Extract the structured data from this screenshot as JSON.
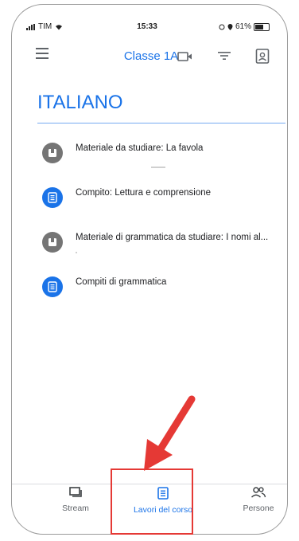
{
  "status_bar": {
    "carrier": "TIM",
    "time": "15:33",
    "battery": "61%"
  },
  "app_bar": {
    "title": "Classe 1A"
  },
  "section": {
    "title": "ITALIANO"
  },
  "items": [
    {
      "label": "Materiale da studiare: La favola",
      "icon": "material-icon",
      "type": "material"
    },
    {
      "label": "Compito: Lettura e comprensione",
      "icon": "assignment-icon",
      "type": "assignment"
    },
    {
      "label": "Materiale di grammatica da studiare: I nomi al...",
      "icon": "material-icon",
      "type": "material"
    },
    {
      "label": "Compiti di grammatica",
      "icon": "assignment-icon",
      "type": "assignment"
    }
  ],
  "bottom_nav": {
    "stream": "Stream",
    "lavori": "Lavori del corso",
    "persone": "Persone"
  },
  "colors": {
    "accent": "#1a73e8",
    "highlight": "#e53935",
    "material_icon": "#757575"
  }
}
